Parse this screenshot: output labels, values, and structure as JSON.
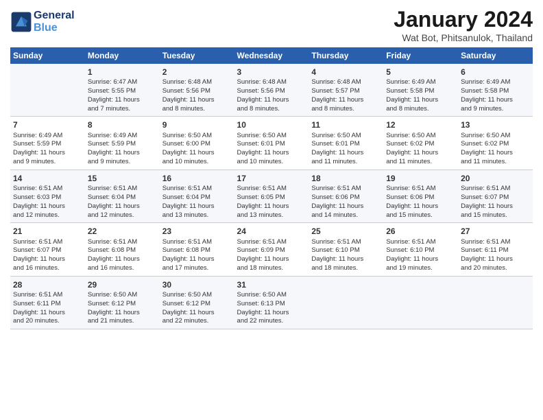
{
  "logo": {
    "text_general": "General",
    "text_blue": "Blue"
  },
  "title": "January 2024",
  "subtitle": "Wat Bot, Phitsanulok, Thailand",
  "headers": [
    "Sunday",
    "Monday",
    "Tuesday",
    "Wednesday",
    "Thursday",
    "Friday",
    "Saturday"
  ],
  "weeks": [
    [
      {
        "day": "",
        "info": ""
      },
      {
        "day": "1",
        "info": "Sunrise: 6:47 AM\nSunset: 5:55 PM\nDaylight: 11 hours\nand 7 minutes."
      },
      {
        "day": "2",
        "info": "Sunrise: 6:48 AM\nSunset: 5:56 PM\nDaylight: 11 hours\nand 8 minutes."
      },
      {
        "day": "3",
        "info": "Sunrise: 6:48 AM\nSunset: 5:56 PM\nDaylight: 11 hours\nand 8 minutes."
      },
      {
        "day": "4",
        "info": "Sunrise: 6:48 AM\nSunset: 5:57 PM\nDaylight: 11 hours\nand 8 minutes."
      },
      {
        "day": "5",
        "info": "Sunrise: 6:49 AM\nSunset: 5:58 PM\nDaylight: 11 hours\nand 8 minutes."
      },
      {
        "day": "6",
        "info": "Sunrise: 6:49 AM\nSunset: 5:58 PM\nDaylight: 11 hours\nand 9 minutes."
      }
    ],
    [
      {
        "day": "7",
        "info": "Sunrise: 6:49 AM\nSunset: 5:59 PM\nDaylight: 11 hours\nand 9 minutes."
      },
      {
        "day": "8",
        "info": "Sunrise: 6:49 AM\nSunset: 5:59 PM\nDaylight: 11 hours\nand 9 minutes."
      },
      {
        "day": "9",
        "info": "Sunrise: 6:50 AM\nSunset: 6:00 PM\nDaylight: 11 hours\nand 10 minutes."
      },
      {
        "day": "10",
        "info": "Sunrise: 6:50 AM\nSunset: 6:01 PM\nDaylight: 11 hours\nand 10 minutes."
      },
      {
        "day": "11",
        "info": "Sunrise: 6:50 AM\nSunset: 6:01 PM\nDaylight: 11 hours\nand 11 minutes."
      },
      {
        "day": "12",
        "info": "Sunrise: 6:50 AM\nSunset: 6:02 PM\nDaylight: 11 hours\nand 11 minutes."
      },
      {
        "day": "13",
        "info": "Sunrise: 6:50 AM\nSunset: 6:02 PM\nDaylight: 11 hours\nand 11 minutes."
      }
    ],
    [
      {
        "day": "14",
        "info": "Sunrise: 6:51 AM\nSunset: 6:03 PM\nDaylight: 11 hours\nand 12 minutes."
      },
      {
        "day": "15",
        "info": "Sunrise: 6:51 AM\nSunset: 6:04 PM\nDaylight: 11 hours\nand 12 minutes."
      },
      {
        "day": "16",
        "info": "Sunrise: 6:51 AM\nSunset: 6:04 PM\nDaylight: 11 hours\nand 13 minutes."
      },
      {
        "day": "17",
        "info": "Sunrise: 6:51 AM\nSunset: 6:05 PM\nDaylight: 11 hours\nand 13 minutes."
      },
      {
        "day": "18",
        "info": "Sunrise: 6:51 AM\nSunset: 6:06 PM\nDaylight: 11 hours\nand 14 minutes."
      },
      {
        "day": "19",
        "info": "Sunrise: 6:51 AM\nSunset: 6:06 PM\nDaylight: 11 hours\nand 15 minutes."
      },
      {
        "day": "20",
        "info": "Sunrise: 6:51 AM\nSunset: 6:07 PM\nDaylight: 11 hours\nand 15 minutes."
      }
    ],
    [
      {
        "day": "21",
        "info": "Sunrise: 6:51 AM\nSunset: 6:07 PM\nDaylight: 11 hours\nand 16 minutes."
      },
      {
        "day": "22",
        "info": "Sunrise: 6:51 AM\nSunset: 6:08 PM\nDaylight: 11 hours\nand 16 minutes."
      },
      {
        "day": "23",
        "info": "Sunrise: 6:51 AM\nSunset: 6:08 PM\nDaylight: 11 hours\nand 17 minutes."
      },
      {
        "day": "24",
        "info": "Sunrise: 6:51 AM\nSunset: 6:09 PM\nDaylight: 11 hours\nand 18 minutes."
      },
      {
        "day": "25",
        "info": "Sunrise: 6:51 AM\nSunset: 6:10 PM\nDaylight: 11 hours\nand 18 minutes."
      },
      {
        "day": "26",
        "info": "Sunrise: 6:51 AM\nSunset: 6:10 PM\nDaylight: 11 hours\nand 19 minutes."
      },
      {
        "day": "27",
        "info": "Sunrise: 6:51 AM\nSunset: 6:11 PM\nDaylight: 11 hours\nand 20 minutes."
      }
    ],
    [
      {
        "day": "28",
        "info": "Sunrise: 6:51 AM\nSunset: 6:11 PM\nDaylight: 11 hours\nand 20 minutes."
      },
      {
        "day": "29",
        "info": "Sunrise: 6:50 AM\nSunset: 6:12 PM\nDaylight: 11 hours\nand 21 minutes."
      },
      {
        "day": "30",
        "info": "Sunrise: 6:50 AM\nSunset: 6:12 PM\nDaylight: 11 hours\nand 22 minutes."
      },
      {
        "day": "31",
        "info": "Sunrise: 6:50 AM\nSunset: 6:13 PM\nDaylight: 11 hours\nand 22 minutes."
      },
      {
        "day": "",
        "info": ""
      },
      {
        "day": "",
        "info": ""
      },
      {
        "day": "",
        "info": ""
      }
    ]
  ]
}
